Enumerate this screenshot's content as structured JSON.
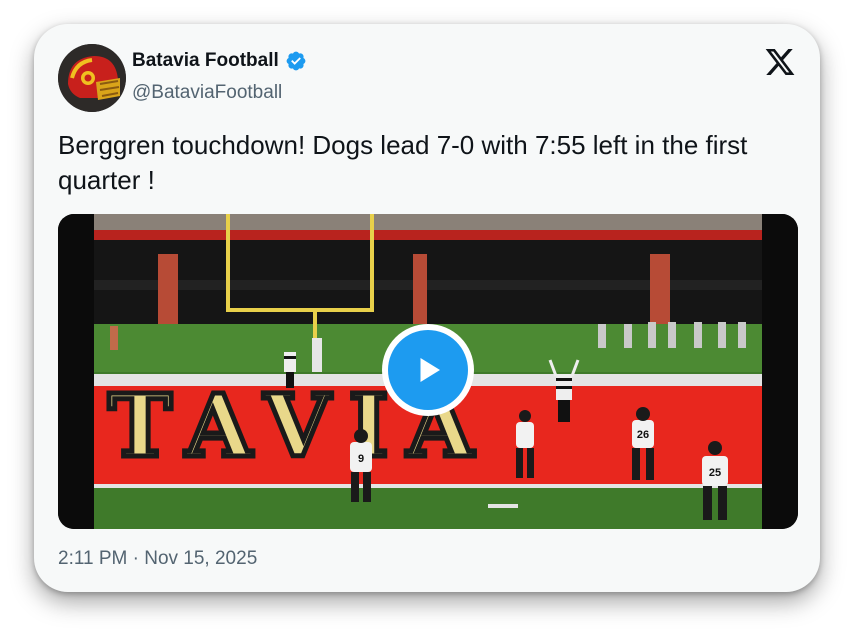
{
  "account": {
    "display_name": "Batavia Football",
    "handle": "@BataviaFootball",
    "verified_icon": "verified-badge-icon",
    "avatar_icon": "helmet-icon"
  },
  "post": {
    "text": "Berggren touchdown! Dogs lead 7-0 with 7:55 left in the first quarter !",
    "timestamp": "2:11 PM · Nov 15, 2025"
  },
  "media": {
    "type": "video",
    "play_icon": "play-icon",
    "endzone_text": "TAVIA",
    "jersey_numbers": [
      "9",
      "26",
      "25"
    ]
  },
  "brand_icon": "x-logo-icon",
  "colors": {
    "accent": "#1d9bf0",
    "text_primary": "#0f1419",
    "text_secondary": "#536471",
    "endzone_red": "#e8271e",
    "endzone_letters": "#e9d88a",
    "field_green": "#3f7a2a"
  }
}
